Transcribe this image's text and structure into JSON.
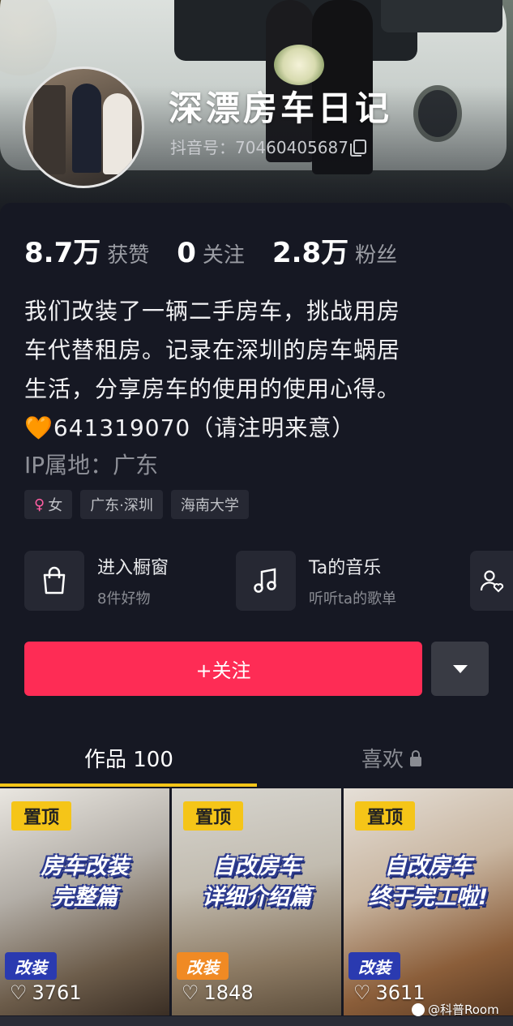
{
  "profile": {
    "nickname": "深漂房车日记",
    "douyin_id": "抖音号：70460405687",
    "stats": [
      {
        "num": "8.7万",
        "label": "获赞"
      },
      {
        "num": "0",
        "label": "关注"
      },
      {
        "num": "2.8万",
        "label": "粉丝"
      }
    ],
    "bio": [
      "我们改装了一辆二手房车，挑战用房",
      "车代替租房。记录在深圳的房车蜗居",
      "生活，分享房车的使用的使用心得。",
      "641319070（请注明来意）"
    ],
    "bio_emoji": "🧡",
    "ip": "IP属地：广东",
    "tags": [
      "女",
      "广东·深圳",
      "海南大学"
    ]
  },
  "entries": {
    "shop": {
      "title": "进入橱窗",
      "sub": "8件好物"
    },
    "music": {
      "title": "Ta的音乐",
      "sub": "听听ta的歌单"
    }
  },
  "actions": {
    "follow_label": "+关注"
  },
  "tabs": {
    "works": "作品 100",
    "likes": "喜欢"
  },
  "videos": [
    {
      "pin": "置顶",
      "title_lines": [
        "房车改装",
        "完整篇"
      ],
      "tag": "改装",
      "likes": "3761"
    },
    {
      "pin": "置顶",
      "title_lines": [
        "自改房车",
        "详细介绍篇"
      ],
      "tag": "改装",
      "likes": "1848"
    },
    {
      "pin": "置顶",
      "title_lines": [
        "自改房车",
        "终于完工啦!"
      ],
      "tag": "改装",
      "likes": "3611"
    }
  ],
  "watermark": "@科普Room",
  "colors": {
    "background": "#161823",
    "follow_button": "#fe2c55",
    "tab_underline": "#f5c518",
    "pin_badge": "#f5c518"
  }
}
